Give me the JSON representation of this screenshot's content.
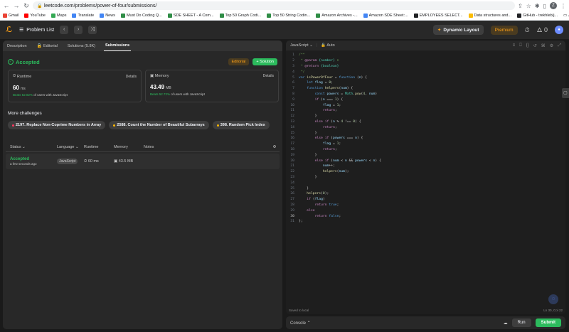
{
  "browser": {
    "url": "leetcode.com/problems/power-of-four/submissions/",
    "profile_initial": "Z",
    "bookmarks": [
      {
        "label": "Gmail",
        "color": "#ea4335"
      },
      {
        "label": "YouTube",
        "color": "#ff0000"
      },
      {
        "label": "Maps",
        "color": "#34a853"
      },
      {
        "label": "Translate",
        "color": "#4285f4"
      },
      {
        "label": "News",
        "color": "#4285f4"
      },
      {
        "label": "Must Do Coding Q...",
        "color": "#2f8d46"
      },
      {
        "label": "SDE SHEET - A Com...",
        "color": "#2f8d46"
      },
      {
        "label": "Top 50 Graph Codi...",
        "color": "#2f8d46"
      },
      {
        "label": "Top 50 String Codin...",
        "color": "#2f8d46"
      },
      {
        "label": "Amazon Archives -...",
        "color": "#2f8d46"
      },
      {
        "label": "Amazon SDE Sheet:...",
        "color": "#4285f4"
      },
      {
        "label": "EMPLOYEES SELECT...",
        "color": "#202124"
      },
      {
        "label": "Data structures and...",
        "color": "#fbbc04"
      },
      {
        "label": "GitHub - trekhleb/j...",
        "color": "#202124"
      }
    ],
    "all_bookmarks": "All Bookmarks"
  },
  "header": {
    "problem_list": "Problem List",
    "dynamic_layout": "Dynamic Layout",
    "premium": "Premium",
    "streak": "0"
  },
  "left": {
    "tabs": [
      {
        "label": "Description",
        "active": false,
        "icon": ""
      },
      {
        "label": "Editorial",
        "active": false,
        "icon": "lock-icon"
      },
      {
        "label": "Solutions (5.8K)",
        "active": false,
        "icon": ""
      },
      {
        "label": "Submissions",
        "active": true,
        "icon": ""
      }
    ],
    "accepted": "Accepted",
    "editorial_btn": "Editorial",
    "solution_btn": "+ Solution",
    "runtime": {
      "title": "Runtime",
      "details": "Details",
      "value": "60",
      "unit": "ms",
      "beats_pct": "Beats 52.82%",
      "beats_rest": "of users with JavaScript"
    },
    "memory": {
      "title": "Memory",
      "details": "Details",
      "value": "43.49",
      "unit": "MB",
      "beats_pct": "Beats 52.72%",
      "beats_rest": "of users with JavaScript"
    },
    "more_title": "More challenges",
    "challenges": [
      {
        "label": "2197. Replace Non-Coprime Numbers in Array",
        "color": "#ff375f"
      },
      {
        "label": "2588. Count the Number of Beautiful Subarrays",
        "color": "#ffb800"
      },
      {
        "label": "398. Random Pick Index",
        "color": "#ffb800"
      }
    ],
    "table": {
      "headers": {
        "status": "Status",
        "language": "Language",
        "runtime": "Runtime",
        "memory": "Memory",
        "notes": "Notes"
      },
      "rows": [
        {
          "status": "Accepted",
          "time": "a few seconds ago",
          "language": "JavaScript",
          "runtime": "60 ms",
          "memory": "43.5 MB"
        }
      ]
    }
  },
  "editor": {
    "language": "JavaScript",
    "mode": "Auto",
    "saved": "Saved to local",
    "position": "Ln 30, Col 22",
    "current_line": 30,
    "lines": [
      "/**",
      " * @param {number} n",
      " * @return {boolean}",
      " */",
      "var isPowerOfFour = function (n) {",
      "    let flag = 0;",
      "    function helpers(num) {",
      "        const powers = Math.pow(4, num)",
      "        if (n === 1) {",
      "            flag = 1;",
      "            return;",
      "        }",
      "        else if (n % 4 !== 0) {",
      "            return;",
      "        }",
      "        else if (powers === n) {",
      "            flag = 1;",
      "            return;",
      "        }",
      "        else if (num < n && powers < n) {",
      "            num++;",
      "            helpers(num);",
      "        }",
      "",
      "    }",
      "    helpers(0);",
      "    if (flag)",
      "        return true;",
      "    else",
      "        return false;",
      "};"
    ]
  },
  "console": {
    "label": "Console",
    "run": "Run",
    "submit": "Submit"
  }
}
